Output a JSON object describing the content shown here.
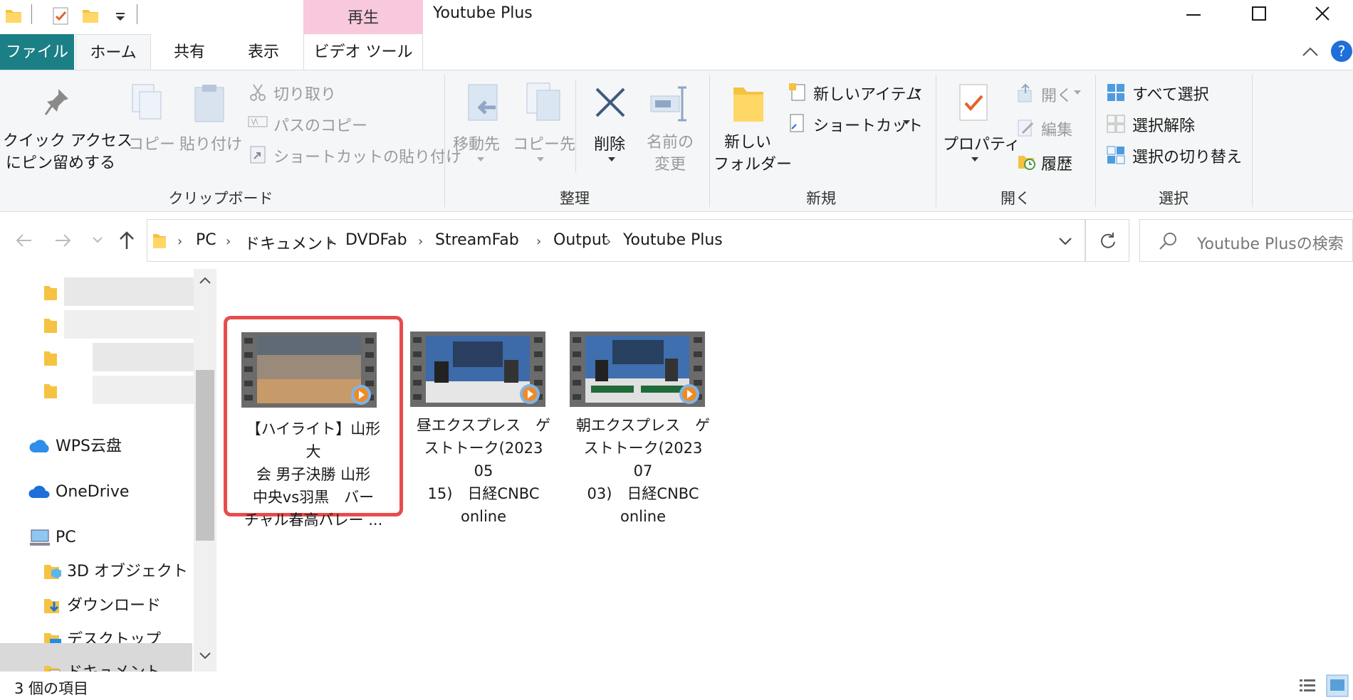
{
  "window": {
    "title": "Youtube Plus",
    "contextual_tab_header": "再生"
  },
  "tabs": {
    "file": "ファイル",
    "home": "ホーム",
    "share": "共有",
    "view": "表示",
    "video_tools": "ビデオ ツール"
  },
  "ribbon": {
    "clipboard": {
      "pin_line1": "クイック アクセス",
      "pin_line2": "にピン留めする",
      "copy": "コピー",
      "paste": "貼り付け",
      "cut": "切り取り",
      "copy_path": "パスのコピー",
      "paste_shortcut": "ショートカットの貼り付け",
      "group": "クリップボード"
    },
    "organize": {
      "move_to": "移動先",
      "copy_to": "コピー先",
      "delete": "削除",
      "rename_line1": "名前の",
      "rename_line2": "変更",
      "group": "整理"
    },
    "new": {
      "new_folder_line1": "新しい",
      "new_folder_line2": "フォルダー",
      "new_item": "新しいアイテム",
      "shortcut": "ショートカット",
      "group": "新規"
    },
    "open": {
      "properties": "プロパティ",
      "open": "開く",
      "edit": "編集",
      "history": "履歴",
      "group": "開く"
    },
    "select": {
      "select_all": "すべて選択",
      "select_none": "選択解除",
      "invert": "選択の切り替え",
      "group": "選択"
    }
  },
  "address": {
    "crumbs": [
      "PC",
      "ドキュメント",
      "DVDFab",
      "StreamFab",
      "Output",
      "Youtube Plus"
    ],
    "search_placeholder": "Youtube Plusの検索"
  },
  "nav": {
    "wps": "WPS云盘",
    "onedrive": "OneDrive",
    "pc": "PC",
    "objects3d": "3D オブジェクト",
    "downloads": "ダウンロード",
    "desktop": "デスクトップ",
    "documents": "ドキュメント"
  },
  "files": [
    {
      "name": "【ハイライト】山形大\n会 男子決勝 山形\n中央vs羽黒　バー\nチャル春高バレー ...",
      "selected": true,
      "thumb": "volleyball-court"
    },
    {
      "name": "昼エクスプレス　ゲ\nストトーク(2023 05\n15)　日経CNBC\nonline",
      "selected": false,
      "thumb": "tv-studio"
    },
    {
      "name": "朝エクスプレス　ゲ\nストトーク(2023 07\n03)　日経CNBC\nonline",
      "selected": false,
      "thumb": "tv-studio"
    }
  ],
  "status": {
    "item_count": "3 個の項目"
  },
  "colors": {
    "file_tab": "#1b7f86",
    "contextual_tab": "#f8c8dc",
    "selection_border": "#e74c4c",
    "help_icon": "#1e6fd9"
  }
}
